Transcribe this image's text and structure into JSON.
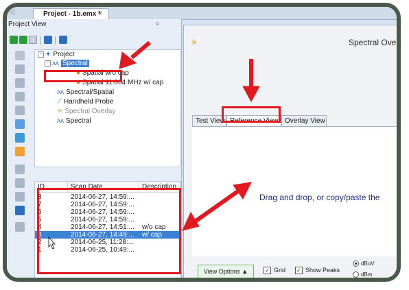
{
  "document_tab": {
    "title": "Project - 1b.emx *",
    "close": "×"
  },
  "project_view": {
    "title": "Project View",
    "pin": "⊕",
    "tree": {
      "root": "Project",
      "items": [
        {
          "label": "Spectral",
          "selected": true
        },
        {
          "label": "Spatial w/o cap"
        },
        {
          "label": "Spatial 11.064 MHz w/ cap"
        },
        {
          "label": "Spectral/Spatial"
        },
        {
          "label": "Handheld Probe"
        },
        {
          "label": "Spectral Overlay",
          "grey": true
        },
        {
          "label": "Spectral"
        }
      ]
    }
  },
  "scan_table": {
    "columns": [
      "ID",
      "Scan Date",
      "Description"
    ],
    "rows": [
      {
        "id": "8",
        "date": "2014-06-27, 14:59:...",
        "desc": ""
      },
      {
        "id": "7",
        "date": "2014-06-27, 14:59:...",
        "desc": ""
      },
      {
        "id": "6",
        "date": "2014-06-27, 14:59:...",
        "desc": ""
      },
      {
        "id": "5",
        "date": "2014-06-27, 14:59:...",
        "desc": ""
      },
      {
        "id": "4",
        "date": "2014-06-27, 14:51:...",
        "desc": "w/o cap"
      },
      {
        "id": "3",
        "date": "2014-06-27, 14:49:...",
        "desc": "w/ cap",
        "selected": true
      },
      {
        "id": "2",
        "date": "2014-06-25, 11:28:...",
        "desc": ""
      },
      {
        "id": "1",
        "date": "2014-06-25, 10:49:...",
        "desc": ""
      }
    ]
  },
  "spectral_panel": {
    "title": "Spectral Overl",
    "tabs": [
      "Test View",
      "Reference View",
      "Overlay View"
    ],
    "active_tab": "Reference View",
    "message": "Drag and drop, or copy/paste the"
  },
  "bottom": {
    "view_options": "View Options ▲",
    "grid_label": "Grid",
    "grid_checked": true,
    "peaks_label": "Show Peaks",
    "peaks_checked": true,
    "unit_dbuv": "dBuV",
    "unit_dbm": "dBm",
    "unit_selected": "dBuV"
  },
  "colors": {
    "highlight": "#e2191f",
    "selection": "#3b82d6",
    "accent_green": "#2a9d3a"
  }
}
